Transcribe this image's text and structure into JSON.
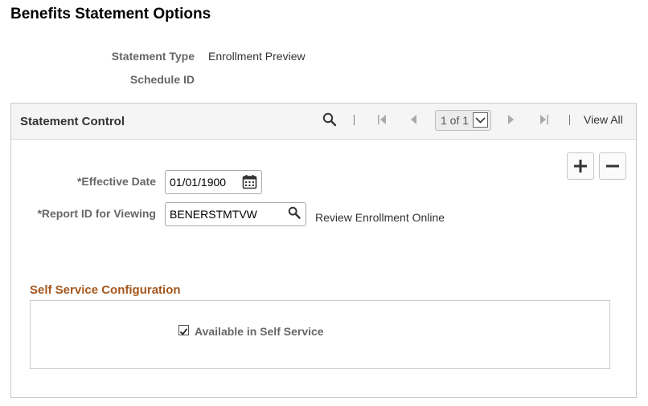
{
  "page": {
    "title": "Benefits Statement Options"
  },
  "header_fields": {
    "statement_type_label": "Statement Type",
    "statement_type_value": "Enrollment Preview",
    "schedule_id_label": "Schedule ID",
    "schedule_id_value": ""
  },
  "grid": {
    "title": "Statement Control",
    "pager_text": "1 of 1",
    "view_all": "View All",
    "add_symbol": "+",
    "remove_symbol": "−"
  },
  "form": {
    "effective_date_label": "*Effective Date",
    "effective_date_value": "01/01/1900",
    "report_id_label": "*Report ID for Viewing",
    "report_id_value": "BENERSTMTVW",
    "report_description": "Review Enrollment Online"
  },
  "self_service": {
    "section_title": "Self Service Configuration",
    "available_label": "Available in Self Service",
    "available_checked": true
  },
  "colors": {
    "section_title": "#a4571e",
    "label_gray": "#666666",
    "header_bg": "#f5f5f5"
  },
  "icons": [
    "search-icon",
    "first-page-icon",
    "previous-icon",
    "next-icon",
    "last-page-icon",
    "calendar-icon",
    "plus-icon",
    "minus-icon",
    "dropdown-arrow-icon",
    "checkmark-icon"
  ]
}
